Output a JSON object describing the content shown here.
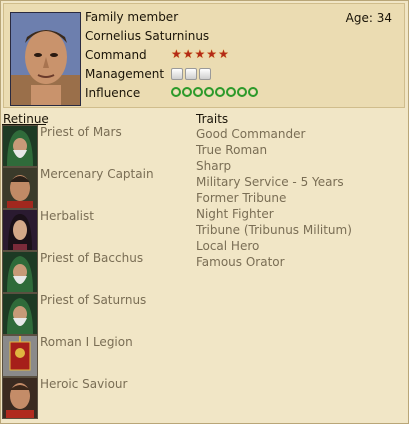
{
  "character": {
    "role": "Family member",
    "name": "Cornelius Saturninus",
    "age_label": "Age: 34",
    "command_label": "Command",
    "command_stars": 5,
    "management_label": "Management",
    "management_level": 3,
    "influence_label": "Influence",
    "influence_level": 8
  },
  "retinue": {
    "title": "Retinue",
    "items": [
      {
        "label": "Priest of Mars",
        "icon": "priest-hooded-icon"
      },
      {
        "label": "Mercenary Captain",
        "icon": "mercenary-portrait-icon"
      },
      {
        "label": "Herbalist",
        "icon": "herbalist-portrait-icon"
      },
      {
        "label": "Priest of Bacchus",
        "icon": "priest-hooded-icon"
      },
      {
        "label": "Priest of Saturnus",
        "icon": "priest-hooded-icon"
      },
      {
        "label": "Roman I Legion",
        "icon": "legion-standard-icon"
      },
      {
        "label": "Heroic Saviour",
        "icon": "soldier-portrait-icon"
      }
    ]
  },
  "traits": {
    "title": "Traits",
    "items": [
      "Good Commander",
      "True Roman",
      "Sharp",
      "Military Service - 5 Years",
      "Former Tribune",
      "Night Fighter",
      "Tribune (Tribunus Militum)",
      "Local Hero",
      "Famous Orator"
    ]
  },
  "colors": {
    "background": "#f1e6c6",
    "star": "#b32a18",
    "laurel": "#2c9a2a",
    "muted_text": "#7a6e55"
  }
}
